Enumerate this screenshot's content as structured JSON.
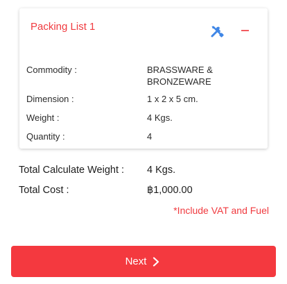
{
  "packing_list": {
    "title": "Packing List 1",
    "fields": [
      {
        "label": "Commodity :",
        "value": "BRASSWARE & BRONZEWARE"
      },
      {
        "label": "Dimension :",
        "value": "1 x 2 x 5 cm."
      },
      {
        "label": "Weight :",
        "value": "4 Kgs."
      },
      {
        "label": "Quantity :",
        "value": "4"
      }
    ],
    "icons": {
      "edit": "tools-icon",
      "remove": "minus-icon"
    }
  },
  "summary": {
    "total_weight_label": "Total Calculate Weight :",
    "total_weight_value": "4 Kgs.",
    "total_cost_label": "Total Cost :",
    "total_cost_value": "฿1,000.00",
    "note": "*Include VAT and Fuel"
  },
  "actions": {
    "next_label": "Next"
  },
  "colors": {
    "accent": "#f4393f",
    "icon_blue": "#3f86e6",
    "title_red": "#f03a3f"
  }
}
